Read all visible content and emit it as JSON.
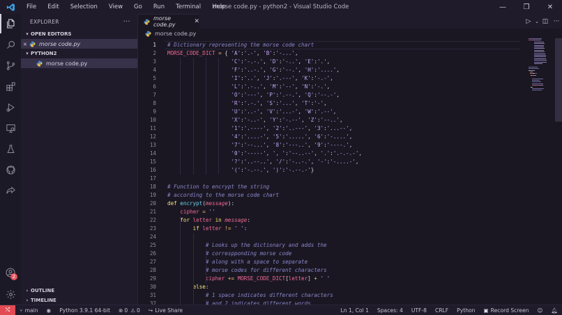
{
  "title_bar": {
    "menu": [
      "File",
      "Edit",
      "Selection",
      "View",
      "Go",
      "Run",
      "Terminal",
      "Help"
    ],
    "window_title": "morse code.py - python2 - Visual Studio Code"
  },
  "activity_bar": {
    "items": [
      "explorer-icon",
      "search-icon",
      "source-control-icon",
      "extensions-icon",
      "run-debug-icon",
      "remote-explorer-icon",
      "testing-icon",
      "github-icon",
      "live-share-icon"
    ],
    "accounts_badge": "2"
  },
  "sidebar": {
    "title": "EXPLORER",
    "more": "···",
    "open_editors": {
      "label": "OPEN EDITORS",
      "files": [
        {
          "name": "morse code.py",
          "close": "×"
        }
      ]
    },
    "folder": {
      "label": "PYTHON2",
      "files": [
        {
          "name": "morse code.py"
        }
      ]
    },
    "outline": "OUTLINE",
    "timeline": "TIMELINE"
  },
  "editor": {
    "tab": {
      "name": "morse code.py",
      "close": "✕"
    },
    "breadcrumb": "morse code.py",
    "current_line": 1,
    "lines": [
      [
        [
          "cm",
          "# Dictionary representing the morse code chart"
        ]
      ],
      [
        [
          "vr",
          "MORSE_CODE_DICT"
        ],
        [
          "op",
          " = "
        ],
        [
          "pl",
          "{ "
        ],
        [
          "st",
          "'A'"
        ],
        [
          "pl",
          ":"
        ],
        [
          "st",
          "'.-'"
        ],
        [
          "pl",
          ", "
        ],
        [
          "st",
          "'B'"
        ],
        [
          "pl",
          ":"
        ],
        [
          "st",
          "'-...'"
        ],
        [
          "pl",
          ","
        ]
      ],
      [
        [
          "pl",
          "                    "
        ],
        [
          "st",
          "'C'"
        ],
        [
          "pl",
          ":"
        ],
        [
          "st",
          "'-.-.'"
        ],
        [
          "pl",
          ", "
        ],
        [
          "st",
          "'D'"
        ],
        [
          "pl",
          ":"
        ],
        [
          "st",
          "'-..'"
        ],
        [
          "pl",
          ", "
        ],
        [
          "st",
          "'E'"
        ],
        [
          "pl",
          ":"
        ],
        [
          "st",
          "'.'"
        ],
        [
          "pl",
          ","
        ]
      ],
      [
        [
          "pl",
          "                    "
        ],
        [
          "st",
          "'F'"
        ],
        [
          "pl",
          ":"
        ],
        [
          "st",
          "'..-.'"
        ],
        [
          "pl",
          ", "
        ],
        [
          "st",
          "'G'"
        ],
        [
          "pl",
          ":"
        ],
        [
          "st",
          "'--.'"
        ],
        [
          "pl",
          ", "
        ],
        [
          "st",
          "'H'"
        ],
        [
          "pl",
          ":"
        ],
        [
          "st",
          "'....'"
        ],
        [
          "pl",
          ","
        ]
      ],
      [
        [
          "pl",
          "                    "
        ],
        [
          "st",
          "'I'"
        ],
        [
          "pl",
          ":"
        ],
        [
          "st",
          "'..'"
        ],
        [
          "pl",
          ", "
        ],
        [
          "st",
          "'J'"
        ],
        [
          "pl",
          ":"
        ],
        [
          "st",
          "'.---'"
        ],
        [
          "pl",
          ", "
        ],
        [
          "st",
          "'K'"
        ],
        [
          "pl",
          ":"
        ],
        [
          "st",
          "'-.-'"
        ],
        [
          "pl",
          ","
        ]
      ],
      [
        [
          "pl",
          "                    "
        ],
        [
          "st",
          "'L'"
        ],
        [
          "pl",
          ":"
        ],
        [
          "st",
          "'.-..'"
        ],
        [
          "pl",
          ", "
        ],
        [
          "st",
          "'M'"
        ],
        [
          "pl",
          ":"
        ],
        [
          "st",
          "'--'"
        ],
        [
          "pl",
          ", "
        ],
        [
          "st",
          "'N'"
        ],
        [
          "pl",
          ":"
        ],
        [
          "st",
          "'-.'"
        ],
        [
          "pl",
          ","
        ]
      ],
      [
        [
          "pl",
          "                    "
        ],
        [
          "st",
          "'O'"
        ],
        [
          "pl",
          ":"
        ],
        [
          "st",
          "'---'"
        ],
        [
          "pl",
          ", "
        ],
        [
          "st",
          "'P'"
        ],
        [
          "pl",
          ":"
        ],
        [
          "st",
          "'.--.'"
        ],
        [
          "pl",
          ", "
        ],
        [
          "st",
          "'Q'"
        ],
        [
          "pl",
          ":"
        ],
        [
          "st",
          "'--.-'"
        ],
        [
          "pl",
          ","
        ]
      ],
      [
        [
          "pl",
          "                    "
        ],
        [
          "st",
          "'R'"
        ],
        [
          "pl",
          ":"
        ],
        [
          "st",
          "'.-.'"
        ],
        [
          "pl",
          ", "
        ],
        [
          "st",
          "'S'"
        ],
        [
          "pl",
          ":"
        ],
        [
          "st",
          "'...'"
        ],
        [
          "pl",
          ", "
        ],
        [
          "st",
          "'T'"
        ],
        [
          "pl",
          ":"
        ],
        [
          "st",
          "'-'"
        ],
        [
          "pl",
          ","
        ]
      ],
      [
        [
          "pl",
          "                    "
        ],
        [
          "st",
          "'U'"
        ],
        [
          "pl",
          ":"
        ],
        [
          "st",
          "'..-'"
        ],
        [
          "pl",
          ", "
        ],
        [
          "st",
          "'V'"
        ],
        [
          "pl",
          ":"
        ],
        [
          "st",
          "'...-'"
        ],
        [
          "pl",
          ", "
        ],
        [
          "st",
          "'W'"
        ],
        [
          "pl",
          ":"
        ],
        [
          "st",
          "'.--'"
        ],
        [
          "pl",
          ","
        ]
      ],
      [
        [
          "pl",
          "                    "
        ],
        [
          "st",
          "'X'"
        ],
        [
          "pl",
          ":"
        ],
        [
          "st",
          "'-..-'"
        ],
        [
          "pl",
          ", "
        ],
        [
          "st",
          "'Y'"
        ],
        [
          "pl",
          ":"
        ],
        [
          "st",
          "'-.--'"
        ],
        [
          "pl",
          ", "
        ],
        [
          "st",
          "'Z'"
        ],
        [
          "pl",
          ":"
        ],
        [
          "st",
          "'--..'"
        ],
        [
          "pl",
          ","
        ]
      ],
      [
        [
          "pl",
          "                    "
        ],
        [
          "st",
          "'1'"
        ],
        [
          "pl",
          ":"
        ],
        [
          "st",
          "'.----'"
        ],
        [
          "pl",
          ", "
        ],
        [
          "st",
          "'2'"
        ],
        [
          "pl",
          ":"
        ],
        [
          "st",
          "'..---'"
        ],
        [
          "pl",
          ", "
        ],
        [
          "st",
          "'3'"
        ],
        [
          "pl",
          ":"
        ],
        [
          "st",
          "'...--'"
        ],
        [
          "pl",
          ","
        ]
      ],
      [
        [
          "pl",
          "                    "
        ],
        [
          "st",
          "'4'"
        ],
        [
          "pl",
          ":"
        ],
        [
          "st",
          "'....-'"
        ],
        [
          "pl",
          ", "
        ],
        [
          "st",
          "'5'"
        ],
        [
          "pl",
          ":"
        ],
        [
          "st",
          "'.....'"
        ],
        [
          "pl",
          ", "
        ],
        [
          "st",
          "'6'"
        ],
        [
          "pl",
          ":"
        ],
        [
          "st",
          "'-....'"
        ],
        [
          "pl",
          ","
        ]
      ],
      [
        [
          "pl",
          "                    "
        ],
        [
          "st",
          "'7'"
        ],
        [
          "pl",
          ":"
        ],
        [
          "st",
          "'--...'"
        ],
        [
          "pl",
          ", "
        ],
        [
          "st",
          "'8'"
        ],
        [
          "pl",
          ":"
        ],
        [
          "st",
          "'---..'"
        ],
        [
          "pl",
          ", "
        ],
        [
          "st",
          "'9'"
        ],
        [
          "pl",
          ":"
        ],
        [
          "st",
          "'----.'"
        ],
        [
          "pl",
          ","
        ]
      ],
      [
        [
          "pl",
          "                    "
        ],
        [
          "st",
          "'0'"
        ],
        [
          "pl",
          ":"
        ],
        [
          "st",
          "'-----'"
        ],
        [
          "pl",
          ", "
        ],
        [
          "st",
          "', '"
        ],
        [
          "pl",
          ":"
        ],
        [
          "st",
          "'--..--'"
        ],
        [
          "pl",
          ", "
        ],
        [
          "st",
          "'.'"
        ],
        [
          "pl",
          ":"
        ],
        [
          "st",
          "'.-.-.-'"
        ],
        [
          "pl",
          ","
        ]
      ],
      [
        [
          "pl",
          "                    "
        ],
        [
          "st",
          "'?'"
        ],
        [
          "pl",
          ":"
        ],
        [
          "st",
          "'..--..'"
        ],
        [
          "pl",
          ", "
        ],
        [
          "st",
          "'/'"
        ],
        [
          "pl",
          ":"
        ],
        [
          "st",
          "'-..-.'"
        ],
        [
          "pl",
          ", "
        ],
        [
          "st",
          "'-'"
        ],
        [
          "pl",
          ":"
        ],
        [
          "st",
          "'-....-'"
        ],
        [
          "pl",
          ","
        ]
      ],
      [
        [
          "pl",
          "                    "
        ],
        [
          "st",
          "'('"
        ],
        [
          "pl",
          ":"
        ],
        [
          "st",
          "'-.--.'"
        ],
        [
          "pl",
          ", "
        ],
        [
          "st",
          "')'"
        ],
        [
          "pl",
          ":"
        ],
        [
          "st",
          "'-.--.-'"
        ],
        [
          "pl",
          "}"
        ]
      ],
      [],
      [
        [
          "cm",
          "# Function to encrypt the string"
        ]
      ],
      [
        [
          "cm",
          "# according to the morse code chart"
        ]
      ],
      [
        [
          "kw",
          "def "
        ],
        [
          "fn",
          "encrypt"
        ],
        [
          "pl",
          "("
        ],
        [
          "pm",
          "message"
        ],
        [
          "pl",
          "):"
        ]
      ],
      [
        [
          "pl",
          "    "
        ],
        [
          "vr",
          "cipher"
        ],
        [
          "op",
          " = "
        ],
        [
          "st",
          "''"
        ]
      ],
      [
        [
          "pl",
          "    "
        ],
        [
          "kw",
          "for "
        ],
        [
          "vr",
          "letter"
        ],
        [
          "kw",
          " in "
        ],
        [
          "pm",
          "message"
        ],
        [
          "pl",
          ":"
        ]
      ],
      [
        [
          "pl",
          "        "
        ],
        [
          "kw",
          "if "
        ],
        [
          "vr",
          "letter"
        ],
        [
          "op",
          " != "
        ],
        [
          "st",
          "' '"
        ],
        [
          "pl",
          ":"
        ]
      ],
      [],
      [
        [
          "pl",
          "            "
        ],
        [
          "cm",
          "# Looks up the dictionary and adds the"
        ]
      ],
      [
        [
          "pl",
          "            "
        ],
        [
          "cm",
          "# correspponding morse code"
        ]
      ],
      [
        [
          "pl",
          "            "
        ],
        [
          "cm",
          "# along with a space to separate"
        ]
      ],
      [
        [
          "pl",
          "            "
        ],
        [
          "cm",
          "# morse codes for different characters"
        ]
      ],
      [
        [
          "pl",
          "            "
        ],
        [
          "vr",
          "cipher"
        ],
        [
          "op",
          " += "
        ],
        [
          "vr",
          "MORSE_CODE_DICT"
        ],
        [
          "pl",
          "["
        ],
        [
          "vr",
          "letter"
        ],
        [
          "pl",
          "] "
        ],
        [
          "op",
          "+ "
        ],
        [
          "st",
          "' '"
        ]
      ],
      [
        [
          "pl",
          "        "
        ],
        [
          "kw",
          "else"
        ],
        [
          "pl",
          ":"
        ]
      ],
      [
        [
          "pl",
          "            "
        ],
        [
          "cm",
          "# 1 space indicates different characters"
        ]
      ],
      [
        [
          "pl",
          "            "
        ],
        [
          "cm",
          "# and 2 indicates different words"
        ]
      ]
    ]
  },
  "status_bar": {
    "branch": "main",
    "interpreter": "Python 3.9.1 64-bit",
    "errors": "0",
    "warnings": "0",
    "live_share": "Live Share",
    "position": "Ln 1, Col 1",
    "indent": "Spaces: 4",
    "encoding": "UTF-8",
    "eol": "CRLF",
    "language": "Python",
    "record": "Record Screen"
  },
  "colors": {
    "accent_red": "#e24b54",
    "comment": "#8a86c9",
    "variable": "#ee6a93",
    "string": "#c3a6f3",
    "keyword": "#f7e379",
    "function": "#6fd0e6"
  }
}
